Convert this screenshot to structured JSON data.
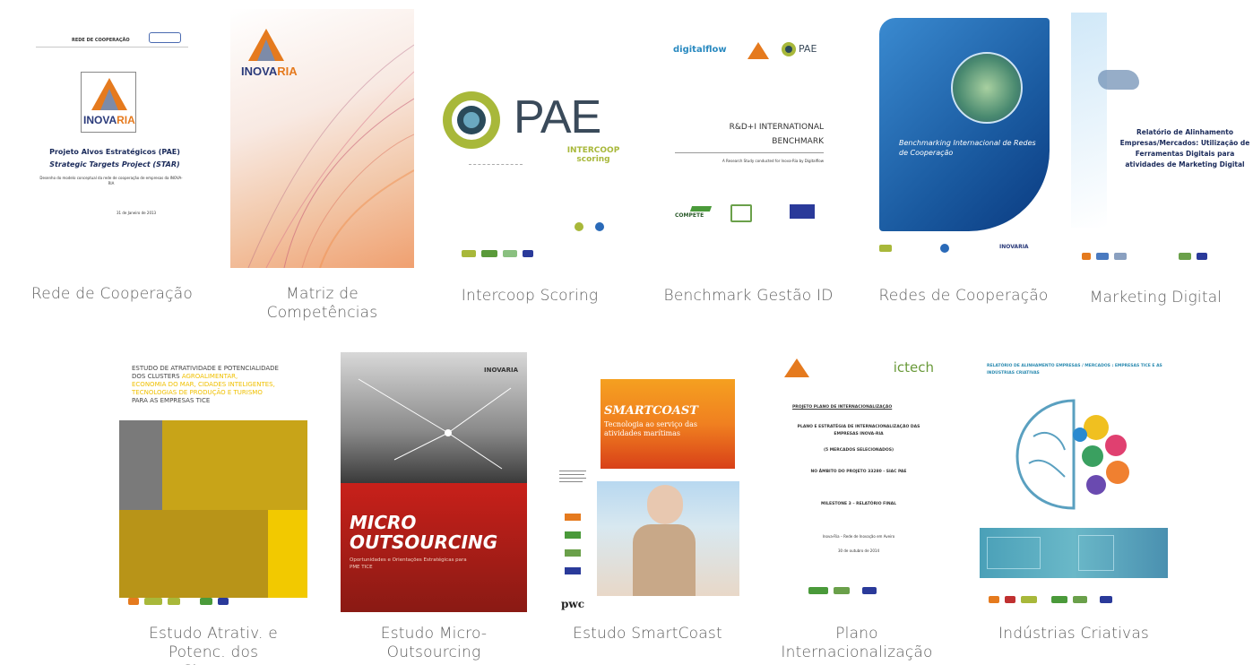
{
  "items": [
    {
      "caption": "Rede de Cooperação",
      "cover": {
        "header": "REDE DE COOPERAÇÃO",
        "logo_left": "INOVA",
        "logo_right": "RIA",
        "title": "Projeto Alvos Estratégicos (PAE)",
        "subtitle": "Strategic Targets Project (STAR)",
        "desc": "Desenho do modelo conceptual da rede de cooperação de empresas da INOVA-RIA",
        "date": "31 de Janeiro de 2013"
      }
    },
    {
      "caption": "Matriz de Competências",
      "cover": {
        "logo_left": "INOVA",
        "logo_right": "RIA"
      }
    },
    {
      "caption": "Intercoop Scoring",
      "cover": {
        "brand": "PAE",
        "tag": "INTERCOOP scoring"
      }
    },
    {
      "caption": "Benchmark Gestão ID",
      "cover": {
        "brand1": "digitalflow",
        "brand2": "PAE",
        "title1": "R&D+I INTERNATIONAL",
        "title2": "BENCHMARK",
        "sub": "A Research Study conducted for Inova-Ria by Digitalflow",
        "compete": "COMPETE"
      }
    },
    {
      "caption": "Redes de Cooperação",
      "cover": {
        "title": "Benchmarking Internacional de Redes de Cooperação",
        "footer": "INOVARIA"
      }
    },
    {
      "caption": "Marketing Digital",
      "cover": {
        "title": "Relatório de Alinhamento Empresas/Mercados: Utilização de Ferramentas Digitais para atividades de Marketing Digital"
      }
    },
    {
      "caption": "Estudo Atrativ. e Potenc. dos Clusters",
      "cover": {
        "line1": "ESTUDO DE ATRATIVIDADE E POTENCIALIDADE",
        "line2": "DOS CLUSTERS",
        "line2b": "AGROALIMENTAR,",
        "line3": "ECONOMIA DO MAR, CIDADES INTELIGENTES,",
        "line4": "TECNOLOGIAS DE PRODUÇÃO E TURISMO",
        "line5": "PARA AS EMPRESAS TICE"
      }
    },
    {
      "caption": "Estudo Micro-Outsourcing",
      "cover": {
        "logo": "INOVARIA",
        "title1": "MICRO",
        "title2": "OUTSOURCING",
        "sub": "Oportunidades e Orientações Estratégicas para PME TICE"
      }
    },
    {
      "caption": "Estudo SmartCoast",
      "cover": {
        "title": "SMARTCOAST",
        "sub": "Tecnologia ao serviço das atividades marítimas",
        "brand": "pwc"
      }
    },
    {
      "caption": "Plano Internacionalização",
      "cover": {
        "brand": "ictech",
        "t1": "PROJETO PLANO DE INTERNACIONALIZAÇÃO",
        "t2": "PLANO E ESTRATÉGIA DE INTERNACIONALIZAÇÃO DAS EMPRESAS INOVA-RIA",
        "t3": "(5 MERCADOS SELECIONADOS)",
        "t4": "NO ÂMBITO DO PROJETO 33280 - SIAC PAE",
        "t5": "MILESTONE 3 – RELATÓRIO FINAL",
        "t6": "Inova-Ria – Rede de Inovação em Aveiro",
        "t7": "30 de outubro de 2014"
      }
    },
    {
      "caption": "Indústrias Criativas",
      "cover": {
        "title": "RELATÓRIO DE ALINHAMENTO EMPRESAS / MERCADOS : EMPRESAS TICE E AS INDÚSTRIAS CRIATIVAS"
      }
    }
  ]
}
